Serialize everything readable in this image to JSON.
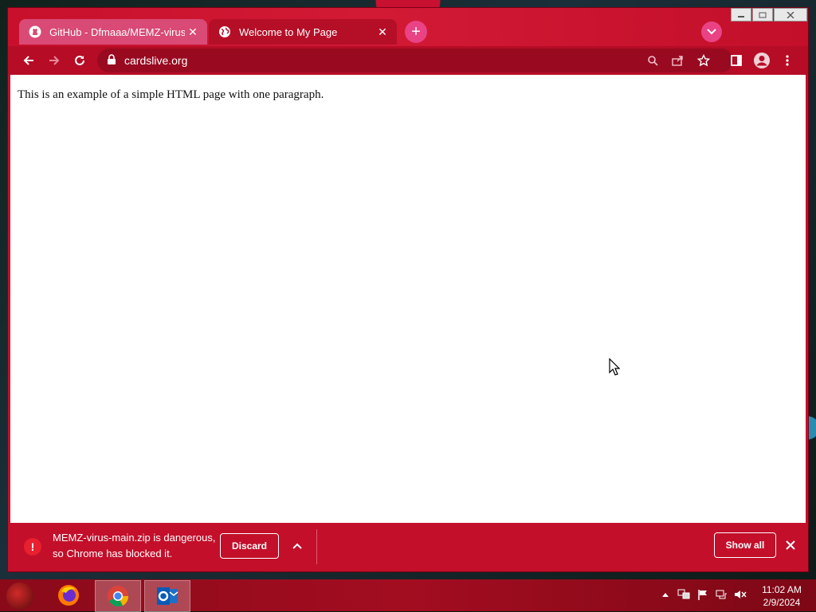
{
  "browser": {
    "tabs": [
      {
        "label": "GitHub - Dfmaaa/MEMZ-virus: Th",
        "icon": "github-icon",
        "active": false
      },
      {
        "label": "Welcome to My Page",
        "icon": "globe-icon",
        "active": true
      }
    ],
    "url": "cardslive.org"
  },
  "page": {
    "paragraph": "This is an example of a simple HTML page with one paragraph."
  },
  "download_bar": {
    "message_line1": "MEMZ-virus-main.zip is dangerous,",
    "message_line2": "so Chrome has blocked it.",
    "discard_label": "Discard",
    "show_all_label": "Show all"
  },
  "taskbar": {
    "apps": [
      {
        "name": "firefox-icon"
      },
      {
        "name": "chrome-icon"
      },
      {
        "name": "outlook-icon"
      }
    ],
    "time": "11:02 AM",
    "date": "2/9/2024"
  },
  "colors": {
    "chrome_frame": "#c5102b",
    "toolbar": "#b60c26",
    "omnibox": "#990a20",
    "accent_pink": "#e94385"
  }
}
